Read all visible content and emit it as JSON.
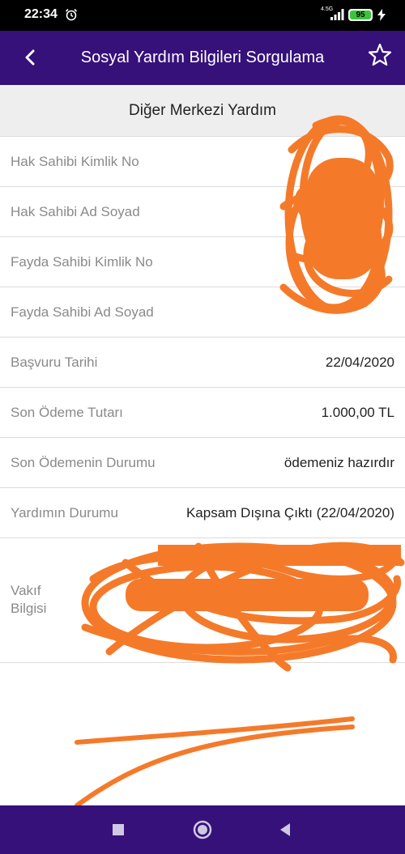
{
  "status_bar": {
    "time": "22:34",
    "network": "4.5G",
    "battery": "95",
    "icons": [
      "alarm-icon",
      "signal-icon",
      "battery-icon",
      "charging-icon"
    ]
  },
  "app_bar": {
    "title": "Sosyal Yardım Bilgileri Sorgulama",
    "icons": [
      "back-arrow-icon",
      "star-icon"
    ]
  },
  "section": {
    "title": "Diğer Merkezi Yardım"
  },
  "rows": [
    {
      "label": "Hak Sahibi Kimlik No",
      "value": ""
    },
    {
      "label": "Hak Sahibi Ad Soyad",
      "value": ""
    },
    {
      "label": "Fayda Sahibi Kimlik No",
      "value": ""
    },
    {
      "label": "Fayda Sahibi Ad Soyad",
      "value": ""
    },
    {
      "label": "Başvuru Tarihi",
      "value": "22/04/2020"
    },
    {
      "label": "Son Ödeme Tutarı",
      "value": "1.000,00 TL"
    },
    {
      "label": "Son Ödemenin Durumu",
      "value": "ödemeniz hazırdır"
    },
    {
      "label": "Yardımın Durumu",
      "value": "Kapsam Dışına Çıktı (22/04/2020)"
    }
  ],
  "vakif": {
    "label": "Vakıf Bilgisi"
  },
  "colors": {
    "primary": "#36117a",
    "scribble": "#f47a2a",
    "battery": "#3ac43a"
  },
  "nav_bar": {
    "icons": [
      "recent-apps-icon",
      "home-icon",
      "back-icon"
    ]
  }
}
